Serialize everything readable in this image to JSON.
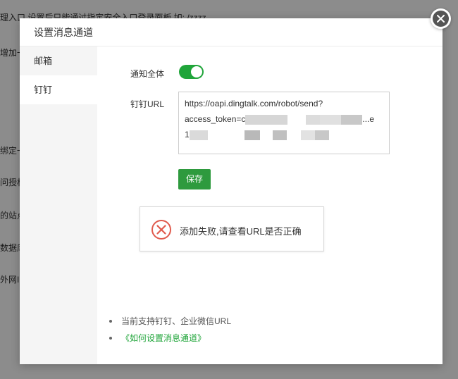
{
  "background": {
    "top_text": "理入口 设置后只能通过指定安全入口登录面板,如: /zzzz",
    "lines": [
      "增加一",
      "绑定一",
      "问授权",
      "的站点",
      "数据库",
      "外网IP"
    ]
  },
  "dialog": {
    "title": "设置消息通道",
    "sidebar": {
      "items": [
        {
          "label": "邮箱"
        },
        {
          "label": "钉钉"
        }
      ]
    },
    "form": {
      "notify_all_label": "通知全体",
      "notify_all_on": true,
      "url_label": "钉钉URL",
      "url_line1": "https://oapi.dingtalk.com/robot/send?",
      "url_line2_prefix": "access_token=c",
      "url_line2_suffix": "...e",
      "url_line3_prefix": "1",
      "save_label": "保存"
    },
    "error": {
      "message": "添加失败,请查看URL是否正确",
      "icon": "error-circle-x-icon"
    },
    "notes": [
      {
        "text": "当前支持钉钉、企业微信URL"
      },
      {
        "text": "《如何设置消息通道》"
      }
    ],
    "accent_color": "#20a53a",
    "error_color": "#e05a4d"
  }
}
